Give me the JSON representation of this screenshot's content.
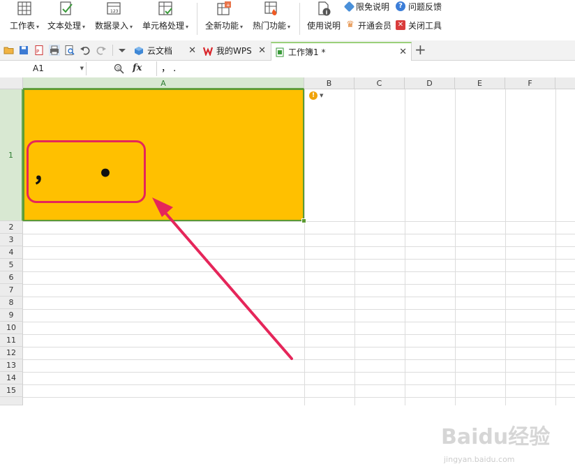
{
  "ribbon": {
    "buttons": [
      {
        "name": "worksheet",
        "label": "工作表",
        "icon": "table-icon"
      },
      {
        "name": "text-processing",
        "label": "文本处理",
        "icon": "text-edit-icon"
      },
      {
        "name": "data-entry",
        "label": "数据录入",
        "icon": "data-entry-icon"
      },
      {
        "name": "cell-processing",
        "label": "单元格处理",
        "icon": "cell-check-icon"
      },
      {
        "name": "new-features",
        "label": "全新功能",
        "icon": "new-feature-icon"
      },
      {
        "name": "hot-features",
        "label": "热门功能",
        "icon": "hot-feature-icon"
      },
      {
        "name": "instructions",
        "label": "使用说明",
        "icon": "instructions-icon"
      }
    ],
    "small": {
      "free_info": "限免说明",
      "feedback": "问题反馈",
      "vip": "开通会员",
      "close_tools": "关闭工具"
    }
  },
  "tabs": [
    {
      "label": "云文档",
      "icon": "cloud-doc-icon",
      "active": false
    },
    {
      "label": "我的WPS",
      "icon": "wps-logo-icon",
      "active": false
    },
    {
      "label": "工作簿1 *",
      "icon": "spreadsheet-icon",
      "active": true
    }
  ],
  "formula_bar": {
    "name_box": "A1",
    "fx_label": "fx",
    "content": "，  ."
  },
  "grid": {
    "columns": [
      "A",
      "B",
      "C",
      "D",
      "E",
      "F"
    ],
    "rows": [
      "1",
      "2",
      "3",
      "4",
      "5",
      "6",
      "7",
      "8",
      "9",
      "10",
      "11",
      "12",
      "13",
      "14",
      "15"
    ],
    "selected_cell": "A1",
    "cell_a1_value": "，     •",
    "cell_a1_fill": "#ffc000"
  },
  "colors": {
    "annotation": "#e5265a",
    "selection": "#5c9a32"
  },
  "watermark": {
    "main": "Baidu经验",
    "sub": "jingyan.baidu.com"
  }
}
